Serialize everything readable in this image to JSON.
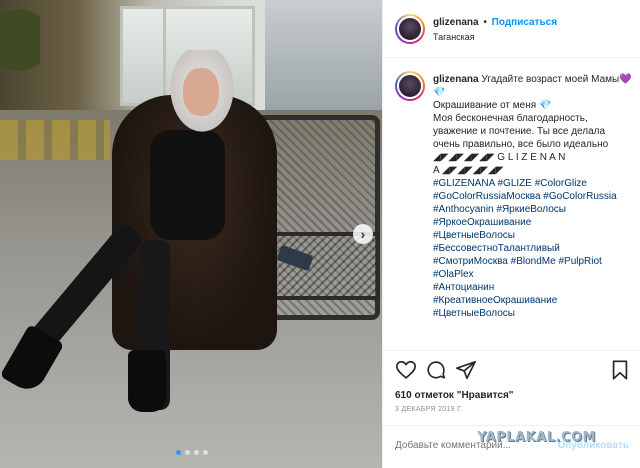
{
  "post": {
    "username": "glizenana",
    "separator": "•",
    "follow_label": "Подписаться",
    "location": "Таганская"
  },
  "caption": {
    "username": "glizenana",
    "line1": "Угадайте возраст моей Мамы",
    "heart": "💜",
    "gem": "💎",
    "line2": "Окрашивание от меня",
    "line3": "Моя бесконечная благодарность, уважение и почтение. Ты все делала очень правильно, все было идеально",
    "deco1": "◢◤◢◤◢◤◢◤ G L I Z E N A N",
    "deco2": "A ◢◤◢◤◢◤◢◤",
    "hashtags": [
      "#GLIZENANA",
      "#GLIZE",
      "#ColorGlize",
      "#GoColorRussiaМосква",
      "#GoColorRussia",
      "#Anthocyanin",
      "#ЯркиеВолосы",
      "#ЯркоеОкрашивание",
      "#ЦветныеВолосы",
      "#БессовестноТалантливый",
      "#СмотриМосква",
      "#BlondMe",
      "#PulpRiot",
      "#OlaPlex",
      "#Антоцианин",
      "#КреативноеОкрашивание",
      "#ЦветныеВолосы"
    ]
  },
  "actions": {
    "like_icon": "heart-icon",
    "comment_icon": "comment-icon",
    "share_icon": "share-icon",
    "save_icon": "bookmark-icon"
  },
  "likes_text": "610 отметок \"Нравится\"",
  "date_text": "3 ДЕКАБРЯ 2019 Г.",
  "comment": {
    "placeholder": "Добавьте комментарий...",
    "publish_label": "Опубликовать"
  },
  "carousel": {
    "next_glyph": "›",
    "dot_count": 4,
    "active_dot": 0
  },
  "watermark": "YAPLAKAL.COM",
  "colors": {
    "accent": "#0095f6",
    "hashtag": "#00376b",
    "muted": "#8e8e8e"
  }
}
